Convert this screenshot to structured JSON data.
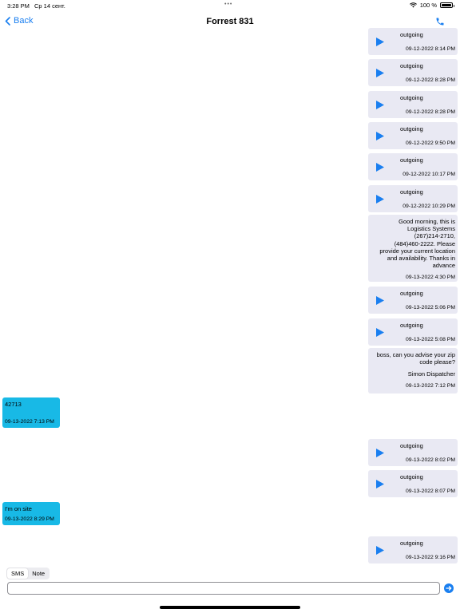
{
  "status_bar": {
    "time": "3:28 PM",
    "date": "Ср 14 сент.",
    "battery": "100 %"
  },
  "nav": {
    "back_label": "Back",
    "title": "Forrest 831"
  },
  "messages": {
    "voice": [
      {
        "label": "outgoing",
        "time": "09-12-2022 8:14 PM"
      },
      {
        "label": "outgoing",
        "time": "09-12-2022 8:28 PM"
      },
      {
        "label": "outgoing",
        "time": "09-12-2022 8:28 PM"
      },
      {
        "label": "outgoing",
        "time": "09-12-2022 9:50 PM"
      },
      {
        "label": "outgoing",
        "time": "09-12-2022 10:17 PM"
      },
      {
        "label": "outgoing",
        "time": "09-12-2022 10:29 PM"
      },
      {
        "label": "outgoing",
        "time": "09-13-2022 5:06 PM"
      },
      {
        "label": "outgoing",
        "time": "09-13-2022 5:08 PM"
      },
      {
        "label": "outgoing",
        "time": "09-13-2022 8:02 PM"
      },
      {
        "label": "outgoing",
        "time": "09-13-2022 8:07 PM"
      },
      {
        "label": "outgoing",
        "time": "09-13-2022 9:16 PM"
      }
    ],
    "text_out": [
      {
        "lines": [
          "Good morning, this is",
          "Logistics Systems",
          "(267)214-2710,",
          "(484)460-2222. Please",
          "provide your current location",
          "and availability. Thanks in",
          "advance"
        ],
        "time": "09-13-2022 4:30 PM"
      },
      {
        "lines": [
          "boss, can you advise your zip",
          "code please?"
        ],
        "signature": "Simon Dispatcher",
        "time": "09-13-2022 7:12 PM"
      }
    ],
    "incoming": [
      {
        "text": "42713",
        "time": "09-13-2022 7:13 PM"
      },
      {
        "text": "I'm on site",
        "time": "09-13-2022 8:29 PM"
      }
    ]
  },
  "composer": {
    "modes": [
      "SMS",
      "Note"
    ],
    "active_mode": "SMS",
    "input_value": "",
    "input_placeholder": ""
  },
  "colors": {
    "accent": "#1a7ff0",
    "outgoing_bg": "#e9e9f3",
    "incoming_bg": "#18b9e6"
  }
}
